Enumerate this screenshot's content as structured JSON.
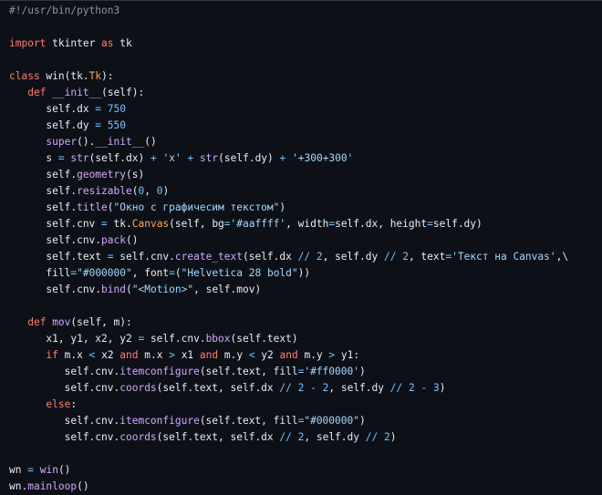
{
  "editor": {
    "language": "python",
    "colors": {
      "background": "#0d1117",
      "text": "#e6edf3",
      "keyword": "#ff7b72",
      "function": "#d2a8ff",
      "class": "#ffa657",
      "string": "#a5d6ff",
      "number": "#79c0ff",
      "operator": "#79c0ff",
      "comment": "#8b949e"
    },
    "lines": [
      [
        [
          "cm",
          "#!/usr/bin/python3"
        ]
      ],
      [],
      [
        [
          "kw",
          "import"
        ],
        [
          "txt",
          " tkinter "
        ],
        [
          "kw",
          "as"
        ],
        [
          "txt",
          " tk"
        ]
      ],
      [],
      [
        [
          "kw",
          "class"
        ],
        [
          "txt",
          " win(tk."
        ],
        [
          "cls",
          "Tk"
        ],
        [
          "txt",
          "):"
        ]
      ],
      [
        [
          "txt",
          "   "
        ],
        [
          "kw",
          "def"
        ],
        [
          "txt",
          " "
        ],
        [
          "fn",
          "__init__"
        ],
        [
          "txt",
          "(self):"
        ]
      ],
      [
        [
          "txt",
          "      self.dx "
        ],
        [
          "op",
          "="
        ],
        [
          "txt",
          " "
        ],
        [
          "num",
          "750"
        ]
      ],
      [
        [
          "txt",
          "      self.dy "
        ],
        [
          "op",
          "="
        ],
        [
          "txt",
          " "
        ],
        [
          "num",
          "550"
        ]
      ],
      [
        [
          "txt",
          "      "
        ],
        [
          "fn",
          "super"
        ],
        [
          "txt",
          "()."
        ],
        [
          "fn",
          "__init__"
        ],
        [
          "txt",
          "()"
        ]
      ],
      [
        [
          "txt",
          "      s "
        ],
        [
          "op",
          "="
        ],
        [
          "txt",
          " "
        ],
        [
          "fn",
          "str"
        ],
        [
          "txt",
          "(self.dx) "
        ],
        [
          "op",
          "+"
        ],
        [
          "txt",
          " "
        ],
        [
          "str",
          "'x'"
        ],
        [
          "txt",
          " "
        ],
        [
          "op",
          "+"
        ],
        [
          "txt",
          " "
        ],
        [
          "fn",
          "str"
        ],
        [
          "txt",
          "(self.dy) "
        ],
        [
          "op",
          "+"
        ],
        [
          "txt",
          " "
        ],
        [
          "str",
          "'+300+300'"
        ]
      ],
      [
        [
          "txt",
          "      self."
        ],
        [
          "fn",
          "geometry"
        ],
        [
          "txt",
          "(s)"
        ]
      ],
      [
        [
          "txt",
          "      self."
        ],
        [
          "fn",
          "resizable"
        ],
        [
          "txt",
          "("
        ],
        [
          "num",
          "0"
        ],
        [
          "txt",
          ", "
        ],
        [
          "num",
          "0"
        ],
        [
          "txt",
          ")"
        ]
      ],
      [
        [
          "txt",
          "      self."
        ],
        [
          "fn",
          "title"
        ],
        [
          "txt",
          "("
        ],
        [
          "str",
          "\"Окно с графичесим текстом\""
        ],
        [
          "txt",
          ")"
        ]
      ],
      [
        [
          "txt",
          "      self.cnv "
        ],
        [
          "op",
          "="
        ],
        [
          "txt",
          " tk."
        ],
        [
          "cls",
          "Canvas"
        ],
        [
          "txt",
          "(self, bg"
        ],
        [
          "op",
          "="
        ],
        [
          "str",
          "'#aaffff'"
        ],
        [
          "txt",
          ", width"
        ],
        [
          "op",
          "="
        ],
        [
          "txt",
          "self.dx, height"
        ],
        [
          "op",
          "="
        ],
        [
          "txt",
          "self.dy)"
        ]
      ],
      [
        [
          "txt",
          "      self.cnv."
        ],
        [
          "fn",
          "pack"
        ],
        [
          "txt",
          "()"
        ]
      ],
      [
        [
          "txt",
          "      self.text "
        ],
        [
          "op",
          "="
        ],
        [
          "txt",
          " self.cnv."
        ],
        [
          "fn",
          "create_text"
        ],
        [
          "txt",
          "(self.dx "
        ],
        [
          "op",
          "//"
        ],
        [
          "txt",
          " "
        ],
        [
          "num",
          "2"
        ],
        [
          "txt",
          ", self.dy "
        ],
        [
          "op",
          "//"
        ],
        [
          "txt",
          " "
        ],
        [
          "num",
          "2"
        ],
        [
          "txt",
          ", text"
        ],
        [
          "op",
          "="
        ],
        [
          "str",
          "'Текст на Canvas'"
        ],
        [
          "txt",
          ",\\"
        ]
      ],
      [
        [
          "txt",
          "      fill"
        ],
        [
          "op",
          "="
        ],
        [
          "str",
          "\"#000000\""
        ],
        [
          "txt",
          ", font"
        ],
        [
          "op",
          "="
        ],
        [
          "txt",
          "("
        ],
        [
          "str",
          "\"Helvetica 28 bold\""
        ],
        [
          "txt",
          "))"
        ]
      ],
      [
        [
          "txt",
          "      self.cnv."
        ],
        [
          "fn",
          "bind"
        ],
        [
          "txt",
          "("
        ],
        [
          "str",
          "\"<Motion>\""
        ],
        [
          "txt",
          ", self.mov)"
        ]
      ],
      [],
      [
        [
          "txt",
          "   "
        ],
        [
          "kw",
          "def"
        ],
        [
          "txt",
          " "
        ],
        [
          "fn",
          "mov"
        ],
        [
          "txt",
          "(self, m):"
        ]
      ],
      [
        [
          "txt",
          "      x1, y1, x2, y2 "
        ],
        [
          "op",
          "="
        ],
        [
          "txt",
          " self.cnv."
        ],
        [
          "fn",
          "bbox"
        ],
        [
          "txt",
          "(self.text)"
        ]
      ],
      [
        [
          "txt",
          "      "
        ],
        [
          "kw",
          "if"
        ],
        [
          "txt",
          " m.x "
        ],
        [
          "op",
          "<"
        ],
        [
          "txt",
          " x2 "
        ],
        [
          "kw",
          "and"
        ],
        [
          "txt",
          " m.x "
        ],
        [
          "op",
          ">"
        ],
        [
          "txt",
          " x1 "
        ],
        [
          "kw",
          "and"
        ],
        [
          "txt",
          " m.y "
        ],
        [
          "op",
          "<"
        ],
        [
          "txt",
          " y2 "
        ],
        [
          "kw",
          "and"
        ],
        [
          "txt",
          " m.y "
        ],
        [
          "op",
          ">"
        ],
        [
          "txt",
          " y1:"
        ]
      ],
      [
        [
          "txt",
          "         self.cnv."
        ],
        [
          "fn",
          "itemconfigure"
        ],
        [
          "txt",
          "(self.text, fill"
        ],
        [
          "op",
          "="
        ],
        [
          "str",
          "'#ff0000'"
        ],
        [
          "txt",
          ")"
        ]
      ],
      [
        [
          "txt",
          "         self.cnv."
        ],
        [
          "fn",
          "coords"
        ],
        [
          "txt",
          "(self.text, self.dx "
        ],
        [
          "op",
          "//"
        ],
        [
          "txt",
          " "
        ],
        [
          "num",
          "2"
        ],
        [
          "txt",
          " "
        ],
        [
          "op",
          "-"
        ],
        [
          "txt",
          " "
        ],
        [
          "num",
          "2"
        ],
        [
          "txt",
          ", self.dy "
        ],
        [
          "op",
          "//"
        ],
        [
          "txt",
          " "
        ],
        [
          "num",
          "2"
        ],
        [
          "txt",
          " "
        ],
        [
          "op",
          "-"
        ],
        [
          "txt",
          " "
        ],
        [
          "num",
          "3"
        ],
        [
          "txt",
          ")"
        ]
      ],
      [
        [
          "txt",
          "      "
        ],
        [
          "kw",
          "else"
        ],
        [
          "txt",
          ":"
        ]
      ],
      [
        [
          "txt",
          "         self.cnv."
        ],
        [
          "fn",
          "itemconfigure"
        ],
        [
          "txt",
          "(self.text, fill"
        ],
        [
          "op",
          "="
        ],
        [
          "str",
          "\"#000000\""
        ],
        [
          "txt",
          ")"
        ]
      ],
      [
        [
          "txt",
          "         self.cnv."
        ],
        [
          "fn",
          "coords"
        ],
        [
          "txt",
          "(self.text, self.dx "
        ],
        [
          "op",
          "//"
        ],
        [
          "txt",
          " "
        ],
        [
          "num",
          "2"
        ],
        [
          "txt",
          ", self.dy "
        ],
        [
          "op",
          "//"
        ],
        [
          "txt",
          " "
        ],
        [
          "num",
          "2"
        ],
        [
          "txt",
          ")"
        ]
      ],
      [],
      [
        [
          "txt",
          "wn "
        ],
        [
          "op",
          "="
        ],
        [
          "txt",
          " "
        ],
        [
          "fn",
          "win"
        ],
        [
          "txt",
          "()"
        ]
      ],
      [
        [
          "txt",
          "wn."
        ],
        [
          "fn",
          "mainloop"
        ],
        [
          "txt",
          "()"
        ]
      ]
    ]
  }
}
